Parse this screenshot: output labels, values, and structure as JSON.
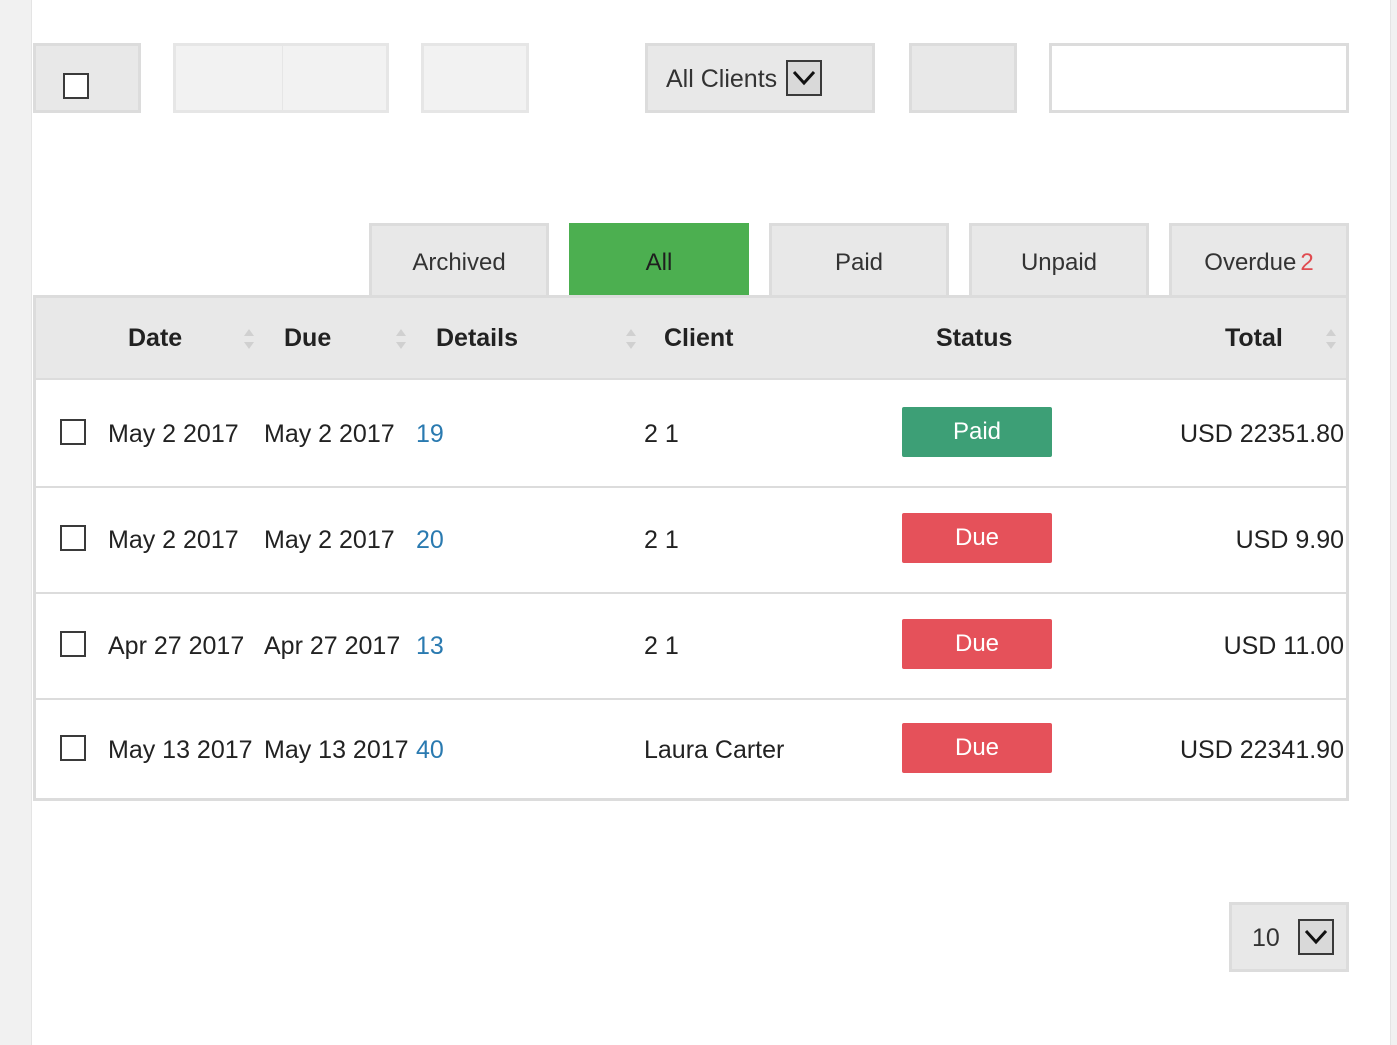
{
  "toolbar": {
    "client_filter_label": "All Clients",
    "search_value": "",
    "dropdown_icon": "chevron-down-icon"
  },
  "tabs": [
    {
      "label": "Archived",
      "active": false
    },
    {
      "label": "All",
      "active": true
    },
    {
      "label": "Paid",
      "active": false
    },
    {
      "label": "Unpaid",
      "active": false
    },
    {
      "label": "Overdue",
      "count": "2",
      "active": false
    }
  ],
  "table": {
    "headers": {
      "date": "Date",
      "due": "Due",
      "details": "Details",
      "client": "Client",
      "status": "Status",
      "total": "Total"
    },
    "rows": [
      {
        "date": "May 2 2017",
        "due": "May 2 2017",
        "details": "19",
        "client": "2 1",
        "status": "Paid",
        "total": "USD 22351.80"
      },
      {
        "date": "May 2 2017",
        "due": "May 2 2017",
        "details": "20",
        "client": "2 1",
        "status": "Due",
        "total": "USD 9.90"
      },
      {
        "date": "Apr 27 2017",
        "due": "Apr 27 2017",
        "details": "13",
        "client": "2 1",
        "status": "Due",
        "total": "USD 11.00"
      },
      {
        "date": "May 13 2017",
        "due": "May 13 2017",
        "details": "40",
        "client": "Laura Carter",
        "status": "Due",
        "total": "USD 22341.90"
      }
    ]
  },
  "status_colors": {
    "Paid": "#3d9f76",
    "Due": "#e5515a"
  },
  "tab_active_color": "#4caf50",
  "link_color": "#2a7ab0",
  "pagination": {
    "per_page": "10"
  }
}
